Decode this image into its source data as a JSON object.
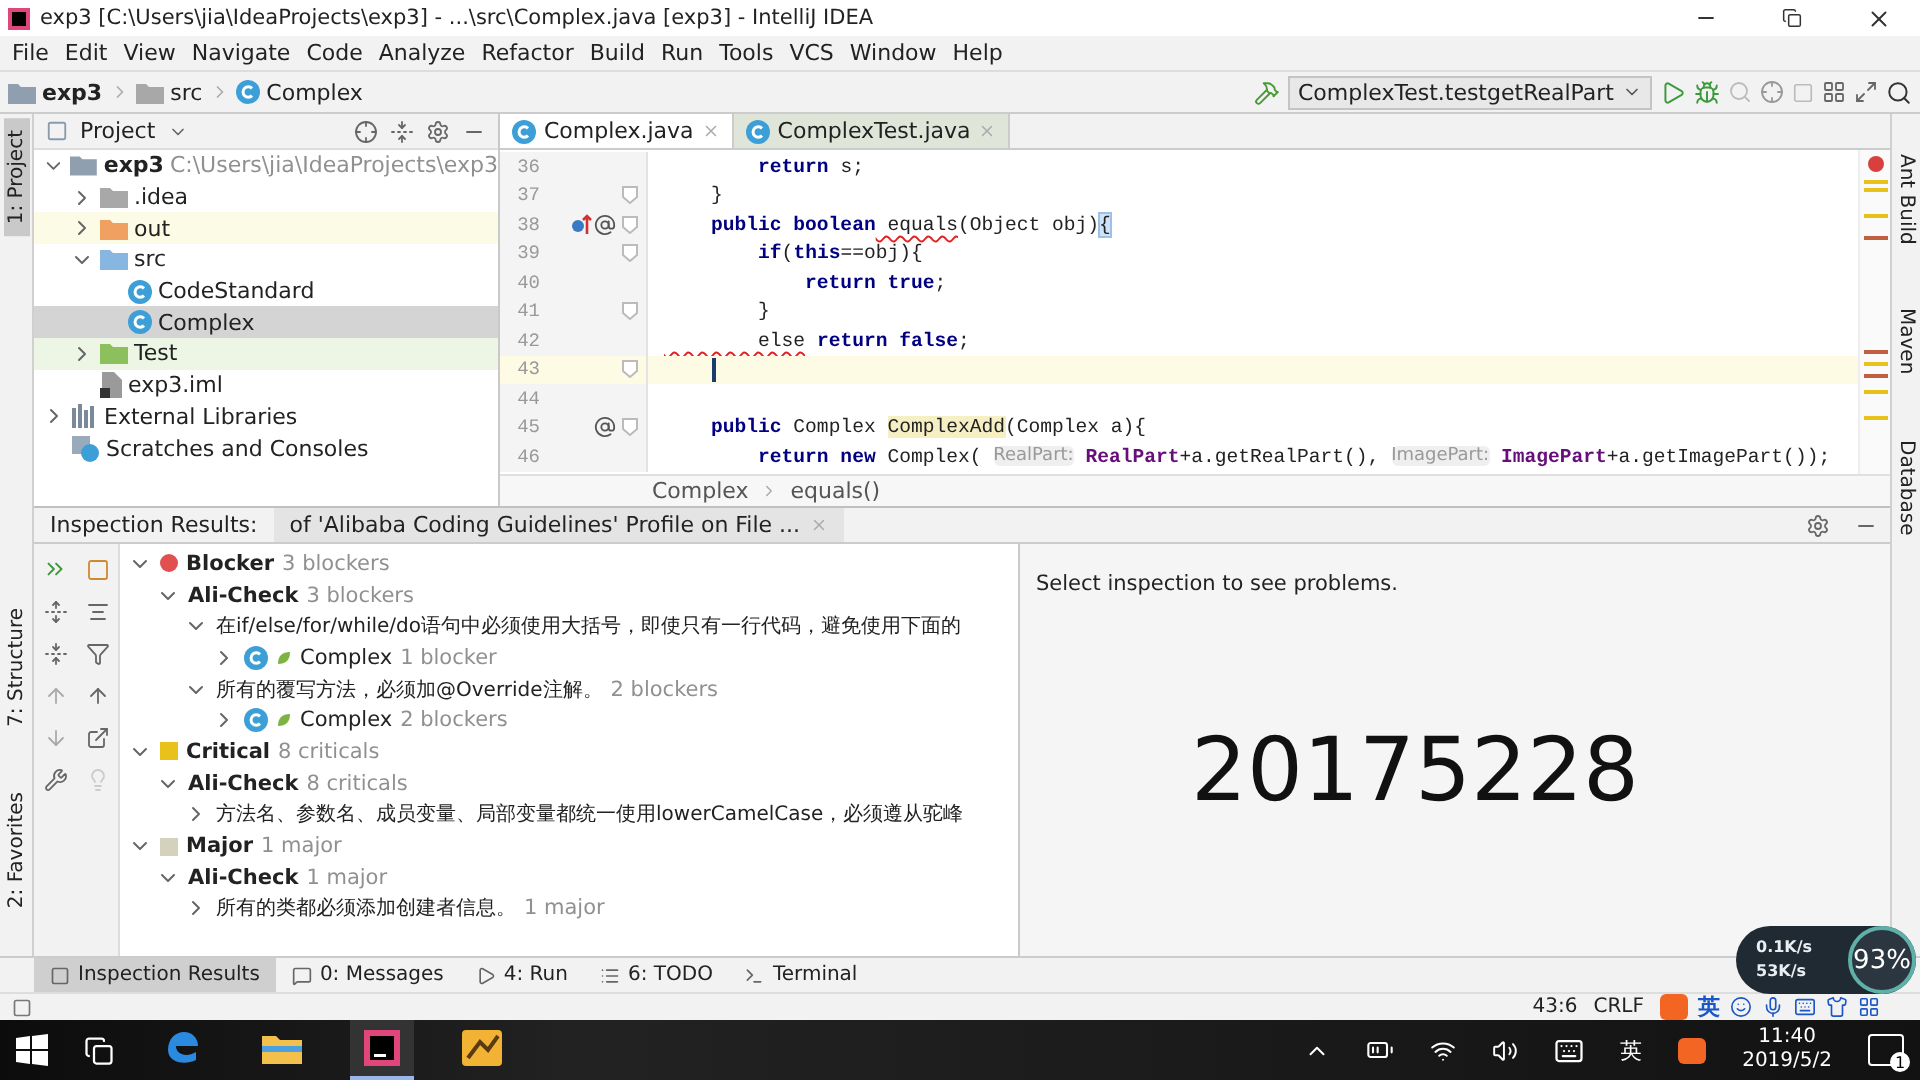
{
  "window": {
    "title": "exp3 [C:\\Users\\jia\\IdeaProjects\\exp3] - ...\\src\\Complex.java [exp3] - IntelliJ IDEA"
  },
  "menu": [
    "File",
    "Edit",
    "View",
    "Navigate",
    "Code",
    "Analyze",
    "Refactor",
    "Build",
    "Run",
    "Tools",
    "VCS",
    "Window",
    "Help"
  ],
  "breadcrumbs": [
    {
      "kind": "module",
      "label": "exp3"
    },
    {
      "kind": "folder",
      "label": "src"
    },
    {
      "kind": "class",
      "label": "Complex"
    }
  ],
  "run_config": "ComplexTest.testgetRealPart",
  "left_stripe": [
    {
      "label": "1: Project",
      "selected": true
    },
    {
      "label": "7: Structure",
      "selected": false
    },
    {
      "label": "2: Favorites",
      "selected": false
    }
  ],
  "right_stripe": [
    "Ant Build",
    "Maven",
    "Database"
  ],
  "project": {
    "title": "Project",
    "tree": [
      {
        "kind": "module",
        "label": "exp3",
        "path": "C:\\Users\\jia\\IdeaProjects\\exp3",
        "expanded": true,
        "selected": false,
        "children": [
          {
            "kind": "folder",
            "label": ".idea",
            "expanded": false,
            "selected": false
          },
          {
            "kind": "excluded",
            "label": "out",
            "expanded": false,
            "selected": false
          },
          {
            "kind": "source",
            "label": "src",
            "expanded": true,
            "selected": false,
            "children": [
              {
                "kind": "class",
                "label": "CodeStandard",
                "selected": false
              },
              {
                "kind": "class",
                "label": "Complex",
                "selected": true
              }
            ]
          },
          {
            "kind": "test",
            "label": "Test",
            "expanded": false,
            "selected": false
          },
          {
            "kind": "file",
            "label": "exp3.iml",
            "selected": false
          }
        ]
      },
      {
        "kind": "library",
        "label": "External Libraries",
        "expanded": false,
        "selected": false
      },
      {
        "kind": "scratch",
        "label": "Scratches and Consoles",
        "selected": false
      }
    ]
  },
  "editor": {
    "tabs": [
      {
        "label": "Complex.java",
        "selected": true
      },
      {
        "label": "ComplexTest.java",
        "selected": false
      }
    ],
    "lines": [
      {
        "number": "36",
        "current": false,
        "segments": [
          {
            "kind": "kw",
            "text": "        return"
          },
          {
            "kind": "txt",
            "text": " s;"
          }
        ]
      },
      {
        "number": "37",
        "current": false,
        "fold": true,
        "segments": [
          {
            "kind": "txt",
            "text": "    }"
          }
        ]
      },
      {
        "number": "38",
        "current": false,
        "fold": true,
        "overridden": true,
        "annotated": true,
        "segments": [
          {
            "kind": "kw",
            "text": "    public boolean"
          },
          {
            "kind": "err",
            "text": " equals"
          },
          {
            "kind": "txt",
            "text": "(Object obj)"
          },
          {
            "kind": "match",
            "text": "{"
          }
        ]
      },
      {
        "number": "39",
        "current": false,
        "fold": true,
        "segments": [
          {
            "kind": "kw",
            "text": "        if"
          },
          {
            "kind": "txt",
            "text": "("
          },
          {
            "kind": "kw",
            "text": "this"
          },
          {
            "kind": "txt",
            "text": "==obj){"
          }
        ]
      },
      {
        "number": "40",
        "current": false,
        "segments": [
          {
            "kind": "kw",
            "text": "            return true"
          },
          {
            "kind": "txt",
            "text": ";"
          }
        ]
      },
      {
        "number": "41",
        "current": false,
        "fold": true,
        "segments": [
          {
            "kind": "txt",
            "text": "        }"
          }
        ]
      },
      {
        "number": "42",
        "current": false,
        "segments": [
          {
            "kind": "err",
            "text": "        else"
          },
          {
            "kind": "kw",
            "text": " return false"
          },
          {
            "kind": "txt",
            "text": ";"
          }
        ]
      },
      {
        "number": "43",
        "current": true,
        "fold": true,
        "caret": true
      },
      {
        "number": "44",
        "current": false
      },
      {
        "number": "45",
        "current": false,
        "fold": true,
        "annotated": true,
        "segments": [
          {
            "kind": "kw",
            "text": "    public"
          },
          {
            "kind": "txt",
            "text": " Complex "
          },
          {
            "kind": "decl",
            "text": "ComplexAdd"
          },
          {
            "kind": "txt",
            "text": "(Complex a){"
          }
        ]
      },
      {
        "number": "46",
        "current": false,
        "segments": [
          {
            "kind": "kw",
            "text": "        return new"
          },
          {
            "kind": "txt",
            "text": " Complex( "
          },
          {
            "kind": "hint",
            "text": "RealPart:"
          },
          {
            "kind": "field",
            "text": " RealPart"
          },
          {
            "kind": "txt",
            "text": "+a.getRealPart(), "
          },
          {
            "kind": "hint",
            "text": "ImagePart:"
          },
          {
            "kind": "field",
            "text": " ImagePart"
          },
          {
            "kind": "txt",
            "text": "+a.getImagePart());"
          }
        ]
      }
    ],
    "breadcrumb": [
      "Complex",
      "equals()"
    ]
  },
  "inspection": {
    "title": "Inspection Results:",
    "tab": "of 'Alibaba Coding Guidelines' Profile on File ...",
    "tree": [
      {
        "kind": "severity",
        "label": "Blocker",
        "count": "3 blockers",
        "color": "#e05050",
        "expanded": true,
        "selected": false,
        "children": [
          {
            "kind": "group",
            "label": "Ali-Check",
            "count": "3 blockers",
            "expanded": true,
            "selected": false,
            "children": [
              {
                "kind": "rule",
                "label": "在if/else/for/while/do语句中必须使用大括号，即使只有一行代码，避免使用下面的",
                "expanded": true,
                "selected": false,
                "children": [
                  {
                    "kind": "file",
                    "label": "Complex",
                    "count": "1 blocker",
                    "expanded": false,
                    "selected": false
                  }
                ]
              },
              {
                "kind": "rule",
                "label": "所有的覆写方法，必须加@Override注解。",
                "count": "2 blockers",
                "expanded": true,
                "selected": false,
                "children": [
                  {
                    "kind": "file",
                    "label": "Complex",
                    "count": "2 blockers",
                    "expanded": false,
                    "selected": false
                  }
                ]
              }
            ]
          }
        ]
      },
      {
        "kind": "severity",
        "label": "Critical",
        "count": "8 criticals",
        "color": "#e8c21a",
        "expanded": true,
        "selected": false,
        "children": [
          {
            "kind": "group",
            "label": "Ali-Check",
            "count": "8 criticals",
            "expanded": true,
            "selected": false,
            "children": [
              {
                "kind": "rule",
                "label": "方法名、参数名、成员变量、局部变量都统一使用lowerCamelCase，必须遵从驼峰",
                "expanded": false,
                "selected": false
              }
            ]
          }
        ]
      },
      {
        "kind": "severity",
        "label": "Major",
        "count": "1 major",
        "color": "#d4d1bc",
        "expanded": true,
        "selected": false,
        "children": [
          {
            "kind": "group",
            "label": "Ali-Check",
            "count": "1 major",
            "expanded": true,
            "selected": false,
            "children": [
              {
                "kind": "rule",
                "label": "所有的类都必须添加创建者信息。",
                "count": "1 major",
                "expanded": false,
                "selected": false
              }
            ]
          }
        ]
      }
    ],
    "message": "Select inspection to see problems.",
    "big_number": "20175228"
  },
  "tool_tabs": [
    {
      "kind": "inspection",
      "label": "Inspection Results",
      "selected": true
    },
    {
      "kind": "messages",
      "label": "0: Messages",
      "selected": false
    },
    {
      "kind": "run",
      "label": "4: Run",
      "selected": false
    },
    {
      "kind": "todo",
      "label": "6: TODO",
      "selected": false
    },
    {
      "kind": "terminal",
      "label": "Terminal",
      "selected": false
    }
  ],
  "status": {
    "position": "43:6",
    "line_ending": "CRLF",
    "ime": "英"
  },
  "network": {
    "up": "0.1K/s",
    "down": "53K/s",
    "load": "93%"
  },
  "taskbar": {
    "apps": [
      {
        "kind": "edge",
        "active": false
      },
      {
        "kind": "explorer",
        "active": false
      },
      {
        "kind": "intellij",
        "active": true
      },
      {
        "kind": "app",
        "active": false
      }
    ],
    "ime": "英",
    "time": "11:40",
    "date": "2019/5/2",
    "notifications": "1"
  }
}
